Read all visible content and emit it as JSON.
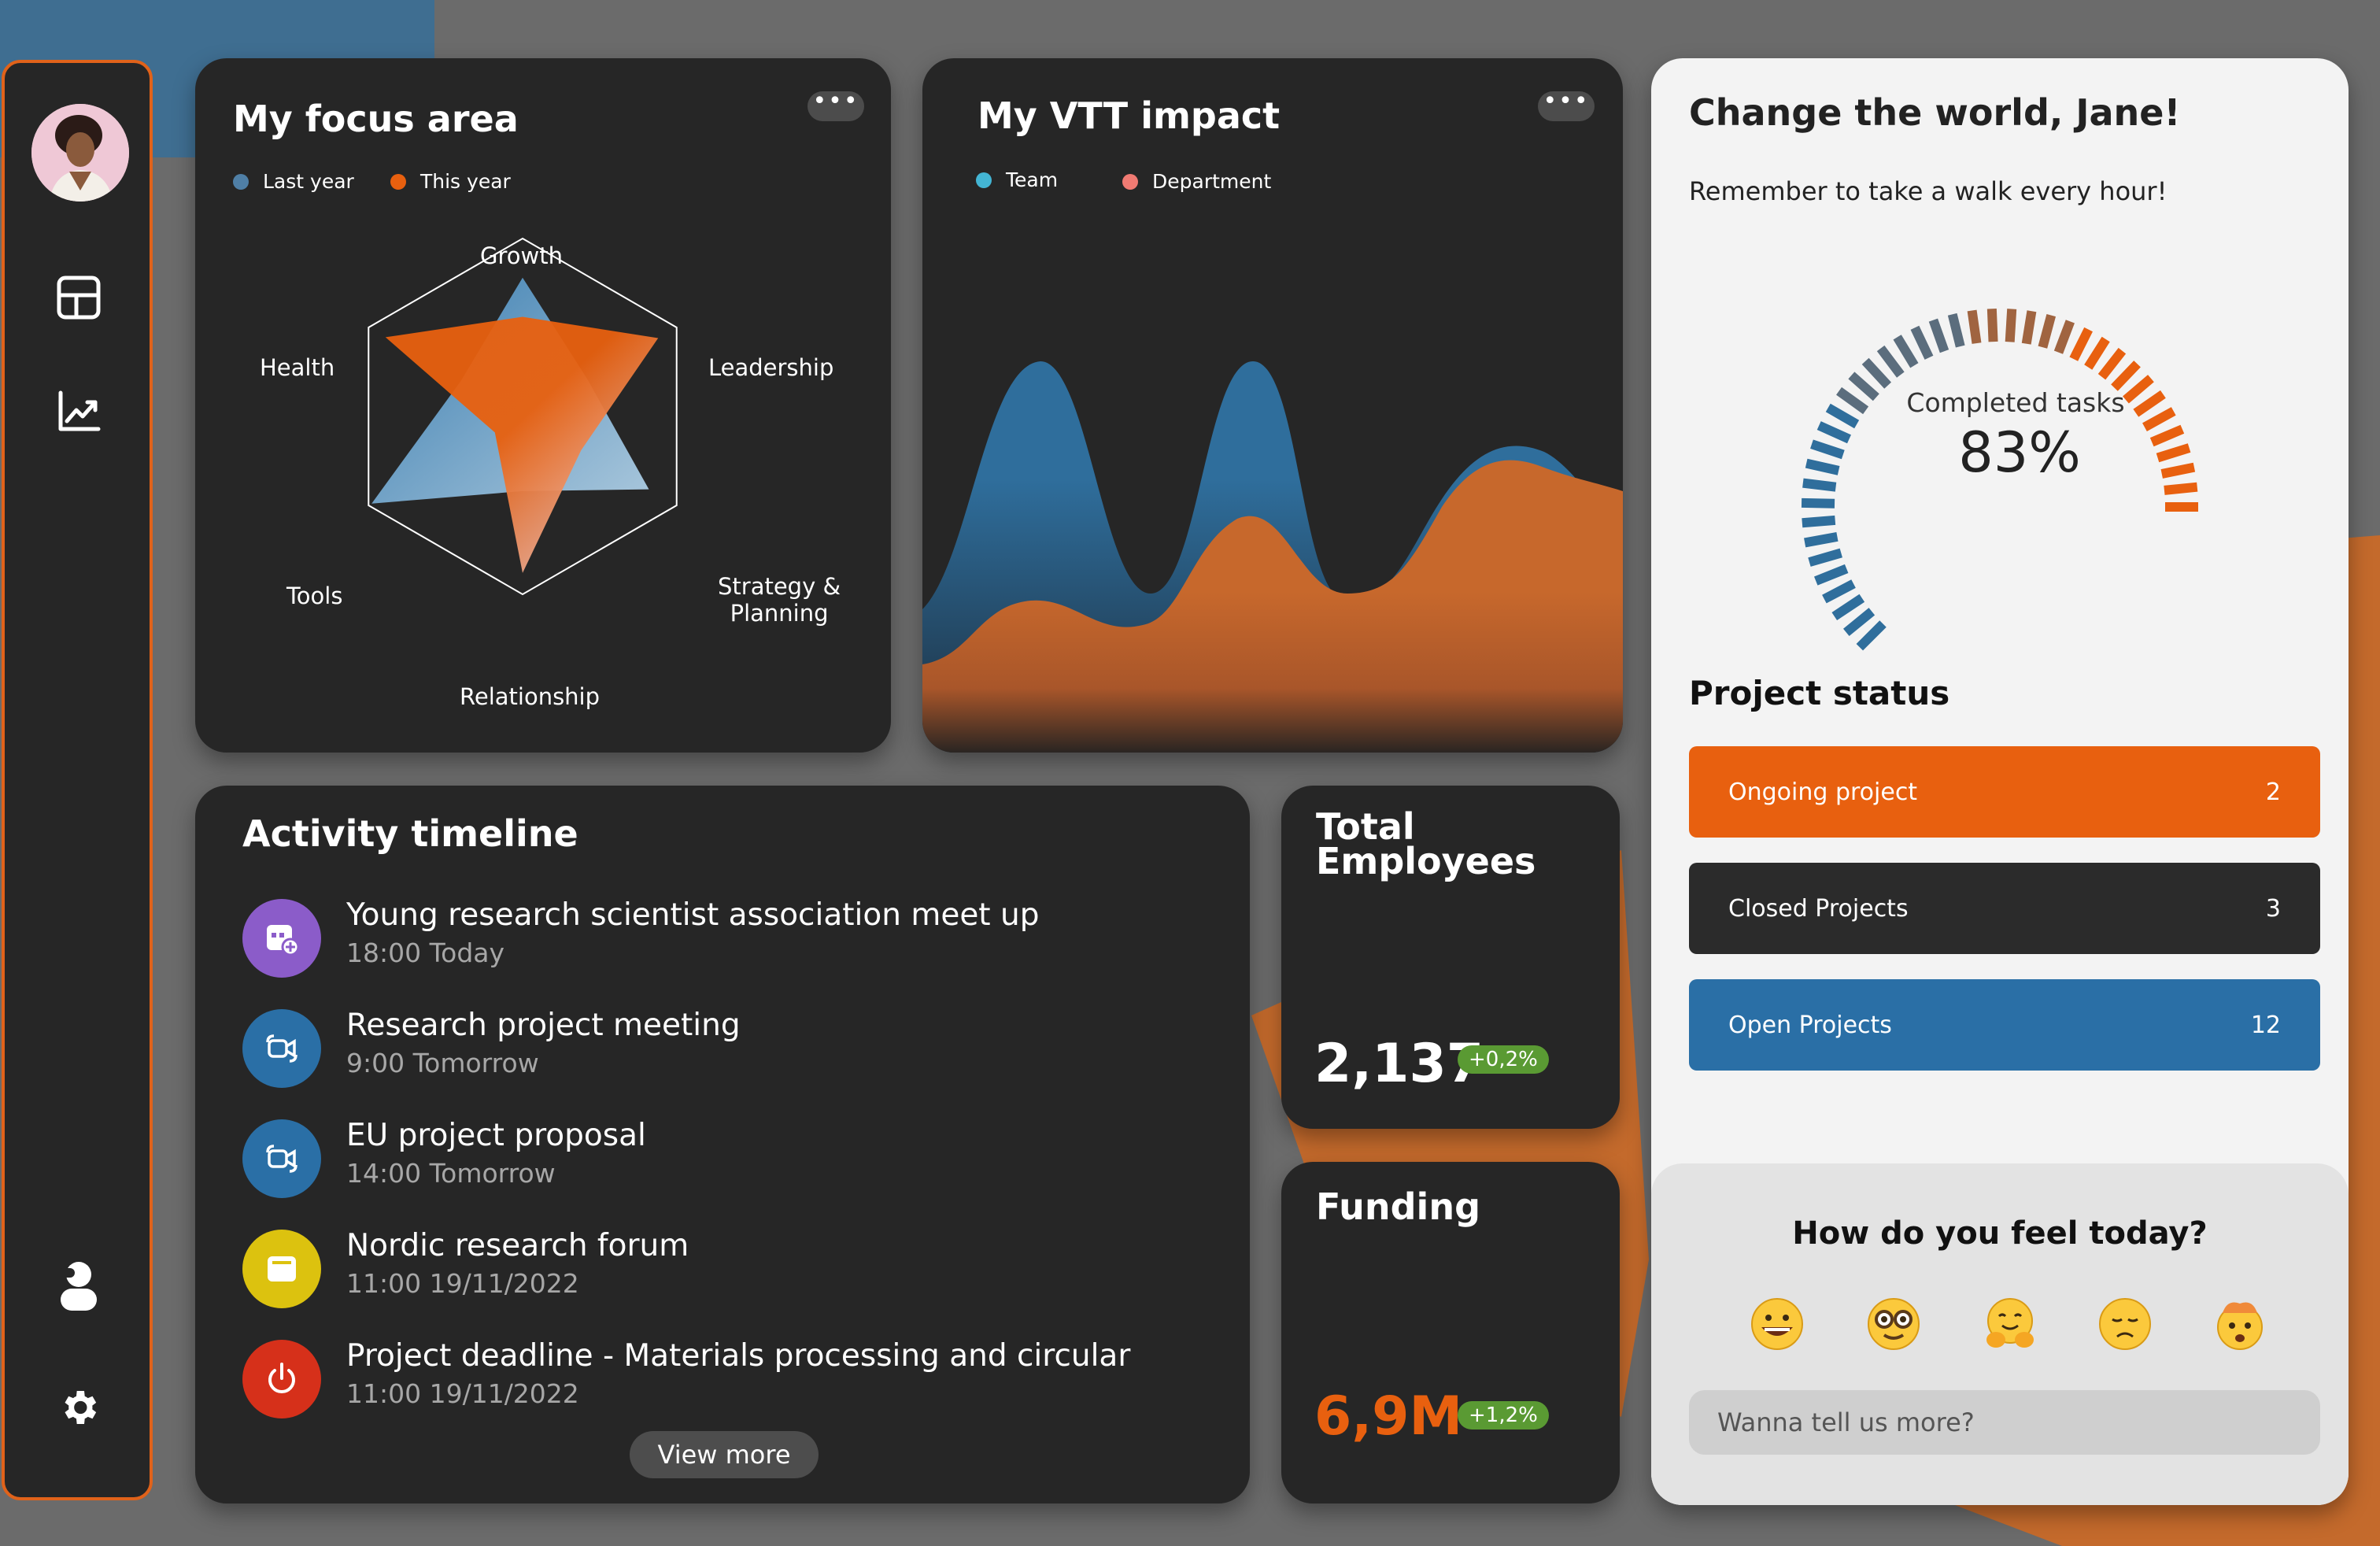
{
  "sidebar": {
    "items": [
      {
        "name": "dashboard-icon"
      },
      {
        "name": "analytics-icon"
      },
      {
        "name": "profile-icon"
      },
      {
        "name": "settings-icon"
      }
    ]
  },
  "focus": {
    "title": "My focus area",
    "menu": "•••",
    "legend": [
      {
        "label": "Last year",
        "color": "#3a7db0"
      },
      {
        "label": "This year",
        "color": "#e8600f"
      }
    ],
    "axes": [
      "Growth",
      "Leadership",
      "Strategy &\nPlanning",
      "Relationship",
      "Tools",
      "Health"
    ],
    "chart_data": {
      "type": "radar",
      "categories": [
        "Growth",
        "Leadership",
        "Strategy & Planning",
        "Relationship",
        "Tools",
        "Health"
      ],
      "series": [
        {
          "name": "Last year",
          "values": [
            0.78,
            0.42,
            0.82,
            0.42,
            0.98,
            0.4
          ]
        },
        {
          "name": "This year",
          "values": [
            0.56,
            0.88,
            0.38,
            0.88,
            0.18,
            0.89
          ]
        }
      ]
    }
  },
  "impact": {
    "title": "My VTT impact",
    "menu": "•••",
    "legend": [
      {
        "label": "Team",
        "color": "#43b5d4"
      },
      {
        "label": "Department",
        "color": "#f07a72"
      }
    ],
    "chart_data": {
      "type": "area",
      "series": [
        {
          "name": "Team",
          "values": [
            0.35,
            0.9,
            0.22,
            0.9,
            0.2,
            0.3,
            0.75,
            0.62
          ]
        },
        {
          "name": "Department",
          "values": [
            0.15,
            0.35,
            0.3,
            0.55,
            0.4,
            0.18,
            0.7,
            0.6
          ]
        }
      ]
    }
  },
  "timeline": {
    "title": "Activity timeline",
    "items": [
      {
        "title": "Young research scientist association meet up",
        "time": "18:00 Today",
        "color": "#8b5cc9",
        "icon": "calendar-add-icon"
      },
      {
        "title": "Research project meeting",
        "time": "9:00 Tomorrow",
        "color": "#2a6fa6",
        "icon": "video-call-icon"
      },
      {
        "title": "EU project proposal",
        "time": "14:00 Tomorrow",
        "color": "#2a6fa6",
        "icon": "video-call-icon"
      },
      {
        "title": "Nordic research forum",
        "time": "11:00 19/11/2022",
        "color": "#dcc20f",
        "icon": "document-icon"
      },
      {
        "title": "Project deadline - Materials processing and circular",
        "time": "11:00 19/11/2022",
        "color": "#d6301a",
        "icon": "power-icon"
      }
    ],
    "view_more": "View more"
  },
  "employees": {
    "title": "Total\nEmployees",
    "value": "2,137",
    "change": "+0,2%"
  },
  "funding": {
    "title": "Funding",
    "value": "6,9M",
    "change": "+1,2%"
  },
  "right": {
    "greeting": "Change the world, Jane!",
    "subtitle": "Remember to take a walk every hour!",
    "gauge_label": "Completed tasks",
    "gauge_value": "83%",
    "gauge_fraction": 0.83,
    "project_title": "Project status",
    "projects": [
      {
        "label": "Ongoing project",
        "count": "2",
        "color": "#e8600f"
      },
      {
        "label": "Closed Projects",
        "count": "3",
        "color": "#2b2b2b"
      },
      {
        "label": "Open Projects",
        "count": "12",
        "color": "#2a6fa6"
      }
    ],
    "feel_title": "How do you feel today?",
    "emojis": [
      "grinning-emoji",
      "nerd-emoji",
      "hugging-emoji",
      "disappointed-emoji",
      "mind-blown-emoji"
    ],
    "input_placeholder": "Wanna tell us more?"
  }
}
